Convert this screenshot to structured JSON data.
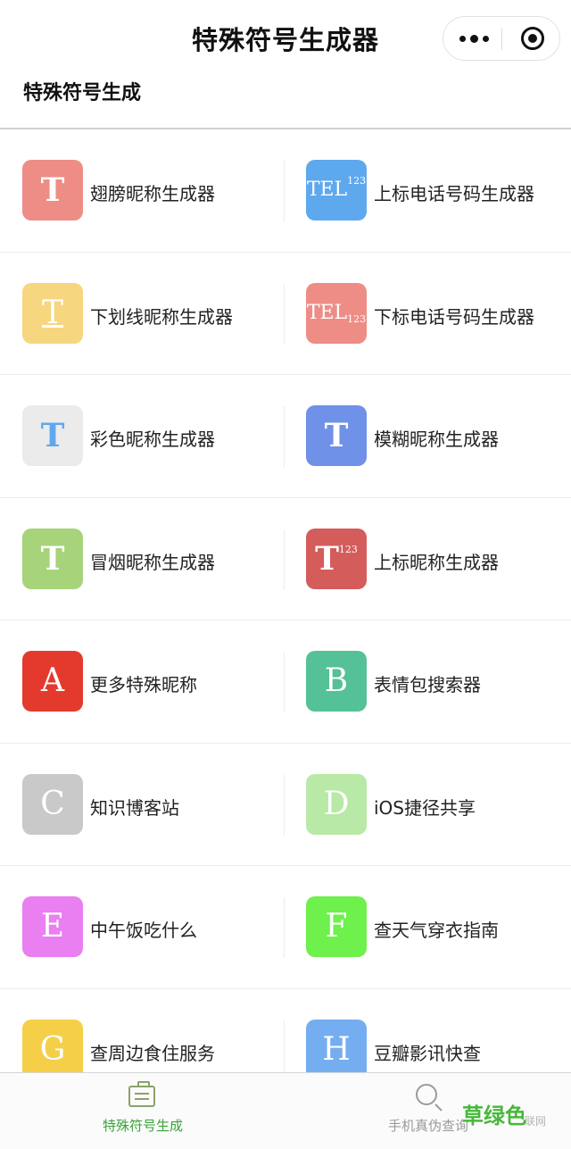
{
  "app": {
    "title": "特殊符号生成器"
  },
  "section": {
    "title": "特殊符号生成"
  },
  "items": [
    {
      "label": "翅膀昵称生成器",
      "color": "#ee8d86",
      "icon": "winged-t-icon"
    },
    {
      "label": "上标电话号码生成器",
      "color": "#5ea8ee",
      "icon": "tel-superscript-icon"
    },
    {
      "label": "下划线昵称生成器",
      "color": "#f6d67e",
      "icon": "underlined-t-icon"
    },
    {
      "label": "下标电话号码生成器",
      "color": "#ee8d86",
      "icon": "tel-subscript-icon"
    },
    {
      "label": "彩色昵称生成器",
      "color": "#ebebeb",
      "icon": "colored-t-icon"
    },
    {
      "label": "模糊昵称生成器",
      "color": "#6f91e8",
      "icon": "blurred-t-icon"
    },
    {
      "label": "冒烟昵称生成器",
      "color": "#a7d37a",
      "icon": "smoking-t-icon"
    },
    {
      "label": "上标昵称生成器",
      "color": "#d45c5b",
      "icon": "t-superscript-icon"
    },
    {
      "label": "更多特殊昵称",
      "color": "#e43a2e",
      "icon": "letter-a-icon"
    },
    {
      "label": "表情包搜索器",
      "color": "#55c196",
      "icon": "letter-b-icon"
    },
    {
      "label": "知识博客站",
      "color": "#c9c9c9",
      "icon": "letter-c-icon"
    },
    {
      "label": "iOS捷径共享",
      "color": "#b8e9a6",
      "icon": "letter-d-icon"
    },
    {
      "label": "中午饭吃什么",
      "color": "#e97ff0",
      "icon": "letter-e-icon"
    },
    {
      "label": "查天气穿衣指南",
      "color": "#6ef04d",
      "icon": "letter-f-icon"
    },
    {
      "label": "查周边食住服务",
      "color": "#f5cf48",
      "icon": "letter-g-icon"
    },
    {
      "label": "豆瓣影讯快查",
      "color": "#74aef0",
      "icon": "letter-h-icon"
    }
  ],
  "glyphs": {
    "t": "T",
    "tel": "TEL",
    "num": "123",
    "a": "A",
    "b": "B",
    "c": "C",
    "d": "D",
    "e": "E",
    "f": "F",
    "g": "G",
    "h": "H"
  },
  "tabs": [
    {
      "label": "特殊符号生成",
      "icon": "bag-icon",
      "active": true
    },
    {
      "label": "手机真伪查询",
      "icon": "search-icon",
      "active": false
    }
  ],
  "watermark": {
    "main": "草绿色",
    "sub": "联网"
  }
}
